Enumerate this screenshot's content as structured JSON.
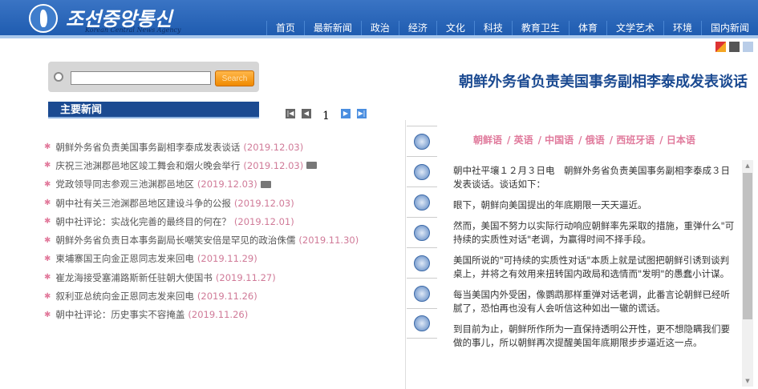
{
  "header": {
    "logo_ko": "조선중앙통신",
    "logo_en": "Korean Central News Agency",
    "nav": [
      "首页",
      "最新新闻",
      "政治",
      "经济",
      "文化",
      "科技",
      "教育卫生",
      "体育",
      "文学艺术",
      "环境",
      "国内新闻"
    ]
  },
  "search": {
    "value": "",
    "button": "Search"
  },
  "section_title": "主要新闻",
  "pager": {
    "page": "1"
  },
  "news": [
    {
      "title": "朝鲜外务省负责美国事务副相李泰成发表谈话",
      "date": "(2019.12.03)",
      "photo": false
    },
    {
      "title": "庆祝三池渊郡邑地区竣工舞会和烟火晚会举行",
      "date": "(2019.12.03)",
      "photo": true
    },
    {
      "title": "党政领导同志参观三池渊郡邑地区",
      "date": "(2019.12.03)",
      "photo": true
    },
    {
      "title": "朝中社有关三池渊郡邑地区建设斗争的公报",
      "date": "(2019.12.03)",
      "photo": false
    },
    {
      "title": "朝中社评论：实战化完善的最终目的何在？",
      "date": "(2019.12.01)",
      "photo": false
    },
    {
      "title": "朝鲜外务省负责日本事务副局长嘲笑安倍是罕见的政治侏儒",
      "date": "(2019.11.30)",
      "photo": false
    },
    {
      "title": "柬埔寨国王向金正恩同志发来回电",
      "date": "(2019.11.29)",
      "photo": false
    },
    {
      "title": "崔龙海接受塞浦路斯新任驻朝大使国书",
      "date": "(2019.11.27)",
      "photo": false
    },
    {
      "title": "叙利亚总统向金正恩同志发来回电",
      "date": "(2019.11.26)",
      "photo": false
    },
    {
      "title": "朝中社评论：历史事实不容掩盖",
      "date": "(2019.11.26)",
      "photo": false
    }
  ],
  "side_icons": [
    "article-icon",
    "video-icon",
    "photo-icon",
    "audio-icon",
    "print-icon",
    "email-icon",
    "share-icon"
  ],
  "article": {
    "title": "朝鲜外务省负责美国事务副相李泰成发表谈话",
    "languages": [
      "朝鲜语",
      "/ 英语",
      "/ 中国语",
      "/ 俄语",
      "/ 西班牙语",
      "/ 日本语"
    ],
    "paragraphs": [
      "朝中社平壤１２月３日电　朝鲜外务省负责美国事务副相李泰成３日发表谈话。谈话如下：",
      "眼下，朝鲜向美国提出的年底期限一天天逼近。",
      "然而，美国不努力以实际行动响应朝鲜率先采取的措施，重弹什么\"可持续的实质性对话\"老调，为赢得时间不择手段。",
      "美国所说的\"可持续的实质性对话\"本质上就是试图把朝鲜引诱到谈判桌上，并将之有效用来扭转国内政局和选情而\"发明\"的愚蠢小计谋。",
      "每当美国内外受困，像鹦鹉那样重弹对话老调，此番言论朝鲜已经听腻了，恐怕再也没有人会听信这种如出一辙的谎话。",
      "到目前为止，朝鲜所作所为一直保持透明公开性，更不想隐瞒我们要做的事儿，所以朝鲜再次提醒美国年底期限步步逼近这一点。"
    ]
  }
}
